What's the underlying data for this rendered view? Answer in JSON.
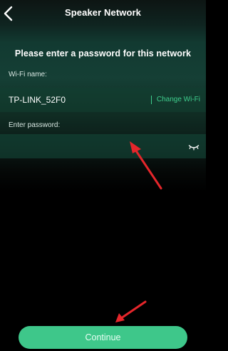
{
  "nav": {
    "title": "Speaker Network"
  },
  "heading": "Please enter a password for this network",
  "wifi": {
    "label": "Wi-Fi name:",
    "name": "TP-LINK_52F0",
    "change_label": "Change Wi-Fi"
  },
  "password": {
    "label": "Enter password:",
    "value": "",
    "placeholder": ""
  },
  "continue_label": "Continue",
  "icons": {
    "back": "chevron-left-icon",
    "eye": "eye-closed-icon",
    "annotation": "red-arrow-icon"
  },
  "colors": {
    "accent": "#3ec78a",
    "accent_text": "#3fcf8e",
    "annotation": "#e5262b"
  }
}
